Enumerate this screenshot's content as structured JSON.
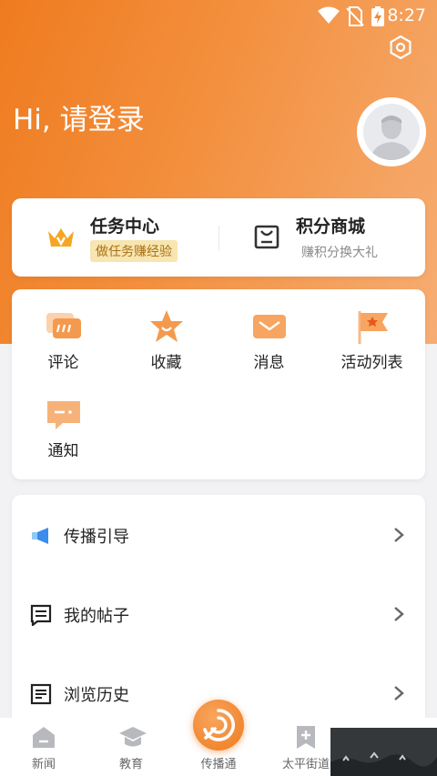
{
  "status": {
    "time": "8:27"
  },
  "profile": {
    "greeting": "Hi, 请登录"
  },
  "quick": {
    "task_title": "任务中心",
    "task_badge": "做任务赚经验",
    "mall_title": "积分商城",
    "mall_sub": "赚积分换大礼"
  },
  "features": [
    {
      "label": "评论",
      "icon": "comment-icon"
    },
    {
      "label": "收藏",
      "icon": "star-icon"
    },
    {
      "label": "消息",
      "icon": "envelope-icon"
    },
    {
      "label": "活动列表",
      "icon": "flag-icon"
    },
    {
      "label": "通知",
      "icon": "notice-icon"
    }
  ],
  "menu": [
    {
      "label": "传播引导",
      "icon": "megaphone-icon"
    },
    {
      "label": "我的帖子",
      "icon": "post-icon"
    },
    {
      "label": "浏览历史",
      "icon": "history-icon"
    }
  ],
  "tabs": [
    {
      "label": "新闻",
      "icon": "home-icon"
    },
    {
      "label": "教育",
      "icon": "graduation-cap-icon"
    },
    {
      "label": "传播通",
      "icon": "broadcast-icon"
    },
    {
      "label": "太平街道",
      "icon": "bookmark-plus-icon"
    }
  ],
  "colors": {
    "accent": "#ef7b1f",
    "accent_light": "#f6ad73",
    "badge_bg": "#f7e5b2",
    "badge_text": "#ab6f10"
  }
}
